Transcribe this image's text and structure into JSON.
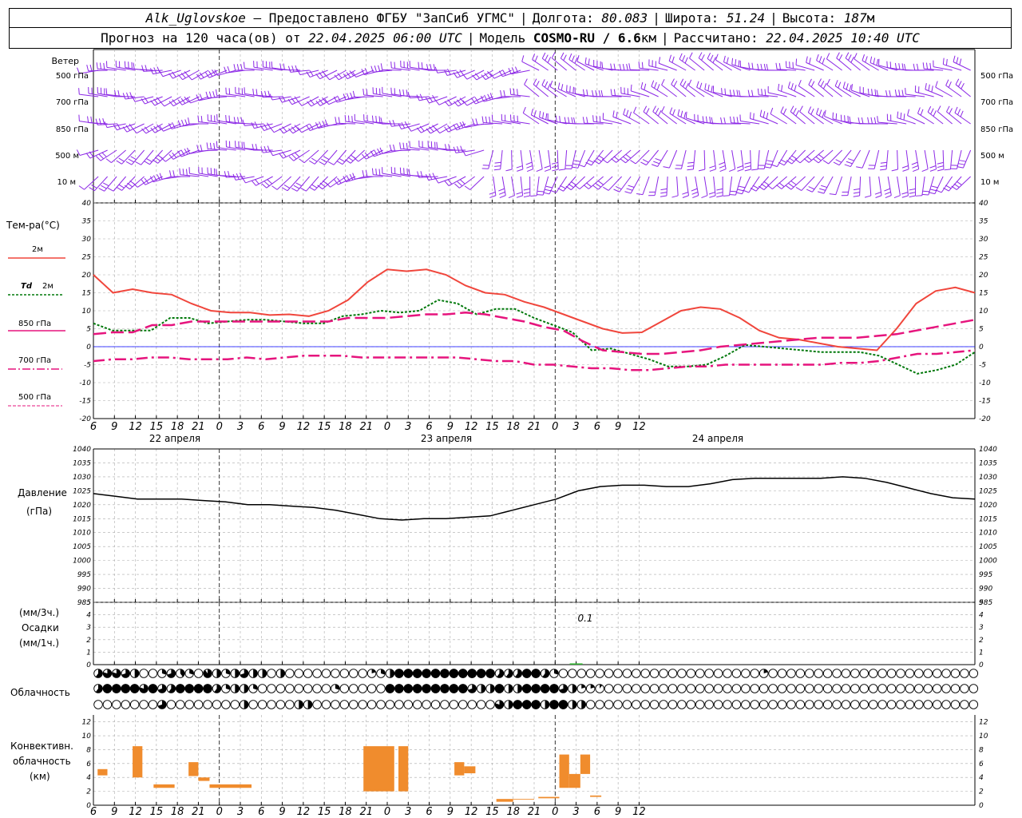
{
  "header": {
    "station": "Alk_Uglovskoe",
    "dash": " – ",
    "provider": "Предоставлено ФГБУ \"ЗапСиб УГМС\"",
    "lon_label": "Долгота:",
    "lon_value": "80.083",
    "lat_label": "Широта:",
    "lat_value": "51.24",
    "alt_label": "Высота:",
    "alt_value": "187",
    "alt_unit": "м",
    "forecast_prefix": "Прогноз на 120 часа(ов) от",
    "forecast_time": "22.04.2025 06:00 UTC",
    "model_label": "Модель",
    "model_value": "COSMO-RU / 6.6",
    "model_unit": "км",
    "calc_label": "Рассчитано:",
    "calc_time": "22.04.2025 10:40 UTC"
  },
  "colors": {
    "t2m": "#f0463c",
    "td2m": "#00780a",
    "t850": "#e6147d",
    "t700": "#e6147d",
    "t500": "#e6147d",
    "wind": "#8c28e6",
    "precip": "#32b432",
    "conv": "#f08c2d",
    "pressure": "#000000",
    "zero_line": "#0000ff"
  },
  "time_axis": {
    "ticks": [
      "6",
      "9",
      "12",
      "15",
      "18",
      "21",
      "0",
      "3",
      "6",
      "9",
      "12",
      "15",
      "18",
      "21",
      "0",
      "3",
      "6",
      "9",
      "12",
      "15",
      "18",
      "21",
      "0",
      "3",
      "6",
      "9",
      "12"
    ],
    "days": [
      "22 апреля",
      "23 апреля",
      "24 апреля"
    ]
  },
  "wind_panel": {
    "title": "Ветер",
    "levels": [
      "500 гПа",
      "700 гПа",
      "850 гПа",
      "500 м",
      "10 м"
    ]
  },
  "temp_legend": {
    "title": "Тем-ра(°С)",
    "t2m": "2м",
    "td_a": "Td",
    "td_b": "2м",
    "t850": "850 гПа",
    "t700": "700 гПа",
    "t500": "500 гПа"
  },
  "pressure_legend": {
    "title": "Давление",
    "unit": "(гПа)"
  },
  "precip_legend": {
    "unit3": "(мм/3ч.)",
    "title": "Осадки",
    "unit1": "(мм/1ч.)",
    "annotation": "0.1"
  },
  "cloud_legend": {
    "title": "Облачность"
  },
  "conv_legend": {
    "line1": "Конвективн.",
    "line2": "облачность",
    "unit": "(км)"
  },
  "chart_data": [
    {
      "type": "line",
      "name": "temperature",
      "x_hours": [
        0,
        3,
        6,
        9,
        12,
        15,
        18,
        21,
        24,
        27,
        30,
        33,
        36,
        39,
        42,
        45,
        48,
        51,
        54,
        57,
        60,
        63,
        66,
        69,
        72,
        75,
        78,
        81,
        84,
        87,
        90,
        93,
        96,
        99,
        102,
        105,
        108,
        111,
        114,
        117,
        120,
        123,
        126
      ],
      "ylim": [
        -20,
        40
      ],
      "yticks": [
        -20,
        -15,
        -10,
        -5,
        0,
        5,
        10,
        15,
        20,
        25,
        30,
        35,
        40
      ],
      "series": [
        {
          "name": "2м",
          "values": [
            20,
            15,
            16,
            15,
            14.5,
            12,
            10,
            9.5,
            9.5,
            8.8,
            9,
            8.5,
            10,
            13,
            18,
            21.5,
            21,
            21.5,
            20,
            17,
            15,
            14.5,
            12.5,
            11,
            9,
            7,
            5,
            3.8,
            4,
            7,
            10,
            11,
            10.5,
            8,
            4.5,
            2.5,
            2,
            1,
            0,
            -0.5,
            -1,
            5,
            12,
            15.5,
            16.5,
            15
          ]
        },
        {
          "name": "Td 2м",
          "values": [
            6.5,
            4.5,
            4.5,
            4.5,
            8,
            8,
            6.5,
            7,
            7.5,
            7.5,
            7,
            6.5,
            6.5,
            8.5,
            9,
            10,
            9.5,
            10,
            13,
            12,
            9,
            10.5,
            10.5,
            8,
            6,
            4,
            -1,
            -0.5,
            -2,
            -3.5,
            -5.5,
            -5.5,
            -5,
            -2.5,
            0.5,
            0,
            -0.5,
            -1,
            -1.5,
            -1.5,
            -1.5,
            -2.5,
            -5,
            -7.5,
            -6.5,
            -5,
            -1.5
          ]
        },
        {
          "name": "850 гПа",
          "values": [
            3.5,
            4,
            4,
            6,
            6,
            7,
            7,
            7,
            7,
            7,
            7,
            7,
            7,
            8,
            8,
            8,
            8.5,
            9,
            9,
            9.5,
            9,
            8,
            7,
            5.5,
            4.5,
            1.5,
            -1,
            -1.5,
            -2,
            -2,
            -1.5,
            -1,
            0,
            0.5,
            1,
            1.5,
            2,
            2.5,
            2.5,
            2.5,
            3,
            3.5,
            4.5,
            5.5,
            6.5,
            7.5
          ]
        },
        {
          "name": "700 гПа",
          "values": [
            -4,
            -3.5,
            -3.5,
            -3,
            -3,
            -3.5,
            -3.5,
            -3.5,
            -3,
            -3.5,
            -3,
            -2.5,
            -2.5,
            -2.5,
            -3,
            -3,
            -3,
            -3,
            -3,
            -3,
            -3.5,
            -4,
            -4,
            -5,
            -5,
            -5.5,
            -6,
            -6,
            -6.5,
            -6.5,
            -6,
            -5.5,
            -5.5,
            -5,
            -5,
            -5,
            -5,
            -5,
            -5,
            -4.5,
            -4.5,
            -4,
            -3,
            -2,
            -2,
            -1.5,
            -1
          ]
        }
      ]
    },
    {
      "type": "line",
      "name": "pressure",
      "x_hours": [
        0,
        3,
        6,
        9,
        12,
        15,
        18,
        21,
        24,
        27,
        30,
        33,
        36,
        39,
        42,
        45,
        48,
        51,
        54,
        57,
        60,
        63,
        66,
        69,
        72,
        75,
        78,
        81,
        84,
        87,
        90,
        93,
        96,
        99,
        102,
        105,
        108,
        111,
        114,
        117,
        120,
        123,
        126
      ],
      "ylim": [
        985,
        1040
      ],
      "yticks": [
        985,
        990,
        995,
        1000,
        1005,
        1010,
        1015,
        1020,
        1025,
        1030,
        1035,
        1040
      ],
      "values": [
        1024,
        1023,
        1022,
        1022,
        1022,
        1021.5,
        1021,
        1020,
        1020,
        1019.5,
        1019,
        1018,
        1016.5,
        1015,
        1014.5,
        1015,
        1015,
        1015.5,
        1016,
        1018,
        1020,
        1022,
        1025,
        1026.5,
        1027,
        1027,
        1026.5,
        1026.5,
        1027.5,
        1029,
        1029.5,
        1029.5,
        1029.5,
        1029.5,
        1030,
        1029.5,
        1028,
        1026,
        1024,
        1022.5,
        1022
      ]
    },
    {
      "type": "bar",
      "name": "precipitation",
      "ylim": [
        0,
        5
      ],
      "values": [
        {
          "hour": 69,
          "value": 0.1
        }
      ]
    },
    {
      "type": "bar",
      "name": "convective_cloud",
      "ylim": [
        0,
        13
      ],
      "yticks": [
        0,
        2,
        4,
        6,
        8,
        10,
        12
      ],
      "bars": [
        {
          "x0": 0.6,
          "x1": 2,
          "bottom": 4.3,
          "top": 5.2
        },
        {
          "x0": 5.6,
          "x1": 7,
          "bottom": 4,
          "top": 8.5
        },
        {
          "x0": 8.6,
          "x1": 11.6,
          "bottom": 2.5,
          "top": 3
        },
        {
          "x0": 13.6,
          "x1": 15,
          "bottom": 4.2,
          "top": 6.2
        },
        {
          "x0": 15,
          "x1": 16.6,
          "bottom": 3.5,
          "top": 4
        },
        {
          "x0": 16.6,
          "x1": 22.6,
          "bottom": 2.5,
          "top": 3
        },
        {
          "x0": 38.6,
          "x1": 43,
          "bottom": 2,
          "top": 8.5
        },
        {
          "x0": 43.6,
          "x1": 45,
          "bottom": 2,
          "top": 8.5
        },
        {
          "x0": 51.6,
          "x1": 53,
          "bottom": 4.3,
          "top": 6.2
        },
        {
          "x0": 53,
          "x1": 54.6,
          "bottom": 4.6,
          "top": 5.6
        },
        {
          "x0": 57.6,
          "x1": 60,
          "bottom": 0.5,
          "top": 0.9
        },
        {
          "x0": 60,
          "x1": 63,
          "bottom": 0.8,
          "top": 0.9
        },
        {
          "x0": 63.6,
          "x1": 66.6,
          "bottom": 1,
          "top": 1.2
        },
        {
          "x0": 66.6,
          "x1": 68,
          "bottom": 2.5,
          "top": 7.3
        },
        {
          "x0": 68,
          "x1": 69.6,
          "bottom": 2.5,
          "top": 4.5
        },
        {
          "x0": 69.6,
          "x1": 71,
          "bottom": 4.5,
          "top": 7.3
        },
        {
          "x0": 71,
          "x1": 72.6,
          "bottom": 1.2,
          "top": 1.4
        }
      ]
    },
    {
      "type": "table",
      "name": "cloud_cover",
      "rows_fraction": [
        [
          0.6,
          0.8,
          0.8,
          0.7,
          0.5,
          0,
          0,
          0.3,
          0.7,
          0.4,
          0.3,
          0,
          0.9,
          0.5,
          0.3,
          0.5,
          0.7,
          0.5,
          0.5,
          0,
          0.5,
          0,
          0,
          0,
          0,
          0,
          0,
          0,
          0,
          0,
          0.2,
          0.3,
          0.5,
          1,
          1,
          1,
          1,
          1,
          1,
          1,
          1,
          1,
          1,
          1,
          0.6,
          0.6,
          0.6,
          1,
          1,
          0.6,
          0.3,
          0,
          0,
          0,
          0,
          0,
          0,
          0,
          0,
          0,
          0,
          0,
          0,
          0,
          0,
          0,
          0,
          0,
          0,
          0,
          0,
          0,
          0,
          0.2,
          0,
          0,
          0,
          0,
          0,
          0,
          0,
          0,
          0,
          0,
          0,
          0,
          0,
          0,
          0,
          0,
          0,
          0,
          0,
          0,
          0,
          0,
          0
        ],
        [
          0.6,
          1,
          1,
          1,
          1,
          0.8,
          1,
          0.7,
          0.6,
          1,
          1,
          1,
          1,
          0.6,
          0.3,
          0.5,
          0.5,
          0.3,
          0,
          0,
          0,
          0,
          0,
          0,
          0,
          0,
          0.3,
          0,
          0,
          0,
          0,
          0,
          1,
          1,
          1,
          1,
          1,
          1,
          1,
          1,
          1,
          0.7,
          0.5,
          0.5,
          1,
          0.5,
          0.5,
          1,
          1,
          1,
          1,
          0.7,
          0.5,
          0.2,
          0.2,
          0.1,
          0,
          0,
          0,
          0,
          0,
          0,
          0,
          0,
          0,
          0,
          0,
          0,
          0,
          0,
          0,
          0,
          0,
          0,
          0,
          0,
          0,
          0,
          0,
          0,
          0,
          0,
          0,
          0,
          0,
          0,
          0,
          0,
          0,
          0,
          0,
          0,
          0,
          0,
          0,
          0,
          0
        ],
        [
          0,
          0,
          0,
          0,
          0,
          0,
          0,
          0.7,
          0,
          0,
          0,
          0,
          0,
          0,
          0,
          0,
          0.5,
          0,
          0,
          0,
          0,
          0,
          0.5,
          0.5,
          0,
          0,
          0,
          0,
          0,
          0,
          0,
          0,
          0,
          0,
          0,
          0,
          0,
          0,
          0,
          0,
          0,
          0,
          0,
          0,
          0.8,
          0.5,
          1,
          1,
          1,
          0.5,
          1,
          1,
          0.5,
          0.5,
          0,
          0,
          0,
          0,
          0,
          0,
          0,
          0,
          0,
          0,
          0,
          0,
          0,
          0,
          0,
          0,
          0,
          0,
          0,
          0,
          0,
          0,
          0,
          0,
          0,
          0,
          0,
          0,
          0,
          0,
          0,
          0,
          0,
          0,
          0,
          0,
          0,
          0,
          0,
          0,
          0,
          0,
          0
        ]
      ]
    }
  ]
}
